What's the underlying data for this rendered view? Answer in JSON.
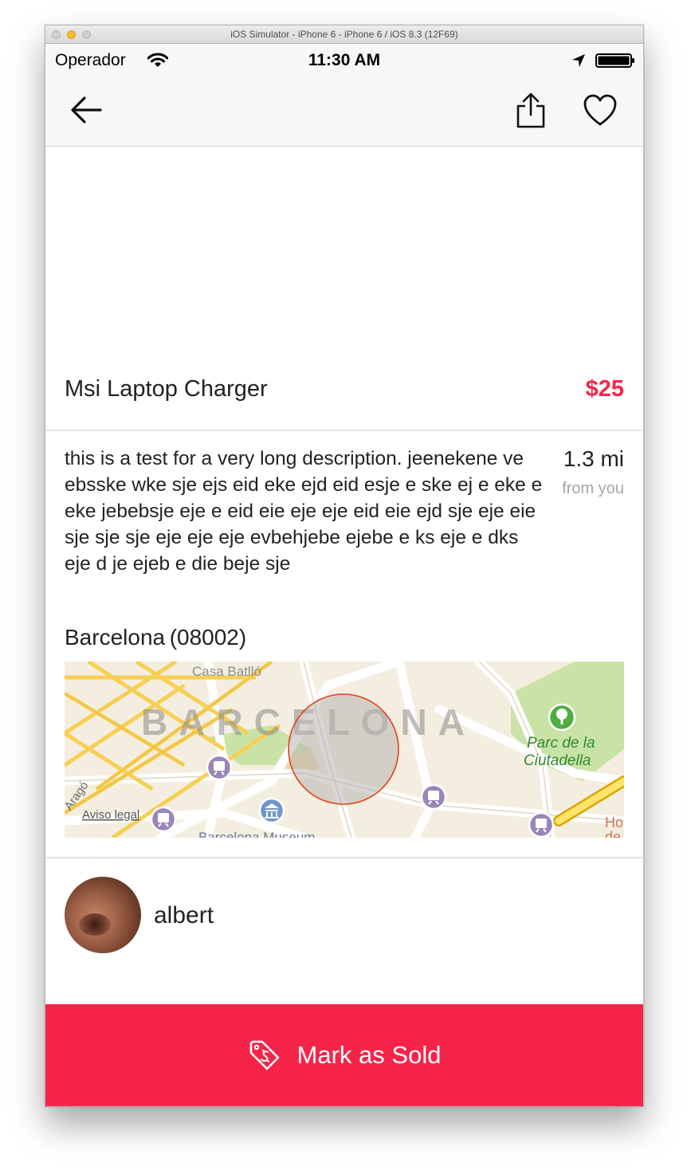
{
  "window": {
    "title": "iOS Simulator - iPhone 6 - iPhone 6 / iOS 8.3 (12F69)"
  },
  "status_bar": {
    "carrier": "Operador",
    "time": "11:30 AM"
  },
  "nav": {
    "back_icon": "arrow-left-icon",
    "share_icon": "share-icon",
    "favorite_icon": "heart-icon"
  },
  "product": {
    "title": "Msi Laptop Charger",
    "price": "$25",
    "description": "this is a test for a very long description. jeenekene ve ebsske wke sje ejs eid eke ejd eid esje e ske ej e eke e eke jebebsje eje e eid eie eje eje eid eie ejd sje eje eie sje sje sje eje eje eje evbehjebe ejebe e ks eje e dks eje d je ejeb e die beje sje",
    "distance": "1.3 mi",
    "distance_caption": "from you",
    "location": "Barcelona (08002)"
  },
  "map": {
    "city_label": "BARCELONA",
    "poi_casa": "Casa Batlló",
    "poi_park_line1": "Parc de la",
    "poi_park_line2": "Ciutadella",
    "poi_museum": "Barcelona Museum",
    "street_arago": "Aragó",
    "legal": "Aviso legal",
    "edge_text_1": "Ho",
    "edge_text_2": "de"
  },
  "seller": {
    "name": "albert"
  },
  "actions": {
    "mark_sold": "Mark as Sold"
  },
  "colors": {
    "accent": "#f7244a",
    "divider": "#e4e4e4",
    "navbar": "#f7f7f7"
  }
}
